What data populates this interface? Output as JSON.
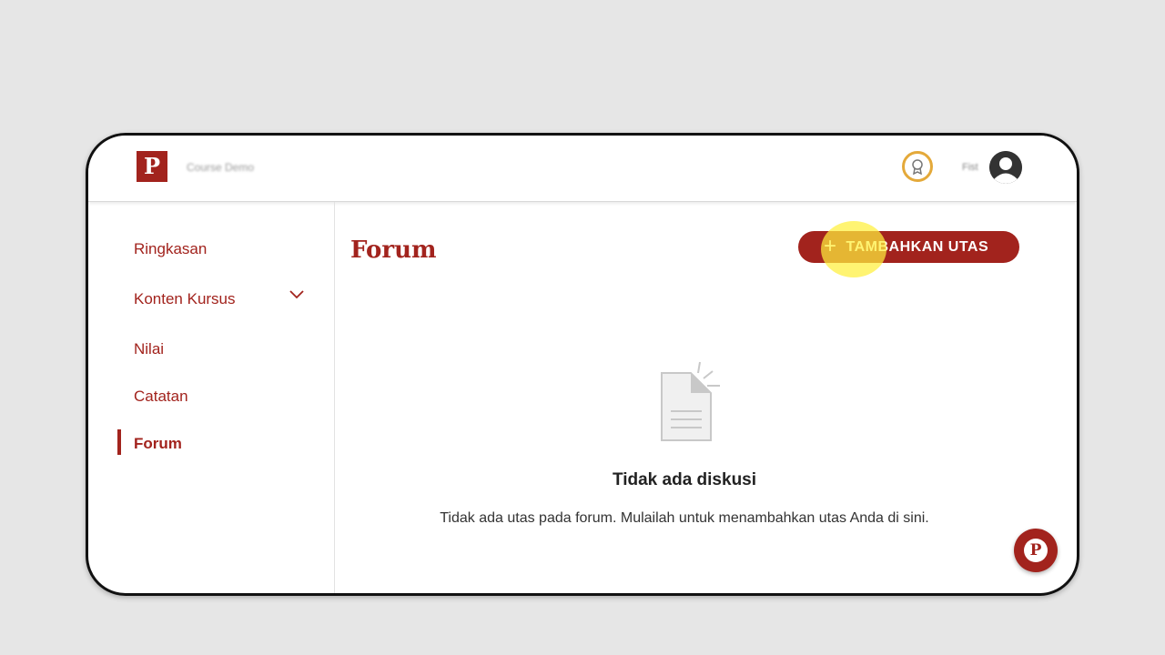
{
  "brand": {
    "logo_letter": "P",
    "course_name": "Course Demo"
  },
  "header": {
    "user_name": "Fist"
  },
  "sidebar": {
    "items": [
      {
        "label": "Ringkasan"
      },
      {
        "label": "Konten Kursus"
      },
      {
        "label": "Nilai"
      },
      {
        "label": "Catatan"
      },
      {
        "label": "Forum"
      }
    ],
    "active": "Forum"
  },
  "main": {
    "title": "Forum",
    "add_button": {
      "icon": "plus-icon",
      "label": "TAMBAHKAN UTAS"
    },
    "empty_state": {
      "icon": "empty-document-icon",
      "title": "Tidak ada diskusi",
      "description": "Tidak ada utas pada forum. Mulailah untuk menambahkan utas Anda di sini."
    }
  },
  "help": {
    "letter": "P"
  },
  "colors": {
    "brand": "#a2231d",
    "badge": "#e4a93a",
    "background": "#e6e6e6"
  }
}
